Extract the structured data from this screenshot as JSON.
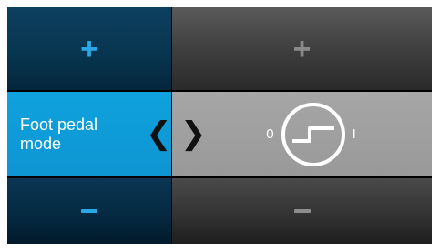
{
  "left_column": {
    "increase_symbol": "+",
    "label": "Foot pedal\nmode",
    "decrease_symbol": "–"
  },
  "right_column": {
    "increase_symbol": "+",
    "state_off": "0",
    "state_on": "I",
    "decrease_symbol": "–"
  },
  "nav": {
    "prev_symbol": "❮",
    "next_symbol": "❯"
  },
  "colors": {
    "active_blue": "#0fa2de",
    "accent_blue": "#2aa7e6",
    "dark_blue": "#073650",
    "grey_panel": "#999999",
    "dark_grey": "#3f3f3f"
  },
  "icons": {
    "pedal": "foot-pedal-step-icon",
    "prev": "chevron-left-icon",
    "next": "chevron-right-icon"
  }
}
